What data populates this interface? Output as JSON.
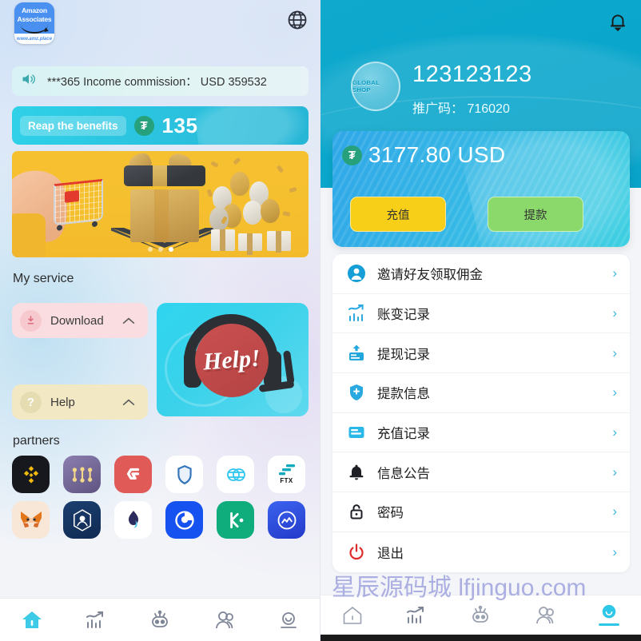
{
  "left": {
    "logo": {
      "line1": "Amazon",
      "line2": "Associates",
      "url": "www.amz.place",
      "icon": "amazon-logo"
    },
    "language_icon": "globe-icon",
    "notice": {
      "icon": "speaker-icon",
      "text": "***365 Income commission： USD 359532"
    },
    "reap": {
      "label": "Reap the benefits",
      "token_icon": "tether-icon",
      "token_symbol": "₮",
      "amount": "135"
    },
    "banner": {
      "alt": "promo-gift-banner",
      "dots": 3,
      "active_dot": 3
    },
    "service_title": "My service",
    "service_items": [
      {
        "label": "Download",
        "icon": "download-icon",
        "chevron": "chevron-up-icon"
      },
      {
        "label": "Help",
        "icon": "question-icon",
        "chevron": "chevron-up-icon"
      }
    ],
    "help_card": {
      "text": "Help!",
      "icon": "headset-icon"
    },
    "partners_title": "partners",
    "partners": [
      {
        "name": "binance",
        "bg": "#16181d",
        "fg": "#f0b90b"
      },
      {
        "name": "pancakeswap",
        "bg": "#6b5f8e",
        "fg": "#f3d27a"
      },
      {
        "name": "gate-io",
        "bg": "#e05a58",
        "fg": "#ffffff"
      },
      {
        "name": "trust-wallet",
        "bg": "#ffffff",
        "fg": "#3375bb"
      },
      {
        "name": "sushiswap",
        "bg": "#ffffff",
        "fg": "#2fc6ef"
      },
      {
        "name": "ftx",
        "bg": "#ffffff",
        "fg": "#11a9bc"
      },
      {
        "name": "metamask",
        "bg": "#f7e4d3",
        "fg": "#e2761b"
      },
      {
        "name": "crypto-com",
        "bg": "#12305c",
        "fg": "#ffffff"
      },
      {
        "name": "1inch",
        "bg": "#ffffff",
        "fg": "#2b2b5e"
      },
      {
        "name": "coinbase",
        "bg": "#1652f0",
        "fg": "#ffffff"
      },
      {
        "name": "kucoin",
        "bg": "#0fac7c",
        "fg": "#ffffff"
      },
      {
        "name": "coinmarketcap",
        "bg": "#2b4fdd",
        "fg": "#ffffff"
      }
    ],
    "tabs": [
      {
        "name": "home",
        "icon": "home-icon",
        "active": true
      },
      {
        "name": "market",
        "icon": "chart-icon",
        "active": false
      },
      {
        "name": "robot",
        "icon": "robot-icon",
        "active": false
      },
      {
        "name": "team",
        "icon": "people-icon",
        "active": false
      },
      {
        "name": "profile",
        "icon": "person-icon",
        "active": false
      }
    ]
  },
  "right": {
    "bell_icon": "bell-icon",
    "avatar": {
      "icon": "globe-shop-icon",
      "text": "GLOBAL SHOP"
    },
    "user_id": "123123123",
    "promo_code": "推广码： 716020",
    "balance": {
      "token_symbol": "₮",
      "token_icon": "tether-icon",
      "amount": "3177.80 USD"
    },
    "actions": [
      {
        "label": "充值",
        "name": "deposit"
      },
      {
        "label": "提款",
        "name": "withdraw"
      }
    ],
    "menu": [
      {
        "label": "邀请好友领取佣金",
        "icon": "user-circle-icon",
        "name": "invite-friends"
      },
      {
        "label": "账变记录",
        "icon": "chart-bars-icon",
        "name": "account-records"
      },
      {
        "label": "提现记录",
        "icon": "withdraw-card-icon",
        "name": "withdrawal-records"
      },
      {
        "label": "提款信息",
        "icon": "shield-plus-icon",
        "name": "withdrawal-info"
      },
      {
        "label": "充值记录",
        "icon": "card-icon",
        "name": "deposit-records"
      },
      {
        "label": "信息公告",
        "icon": "bell-icon",
        "name": "announcements"
      },
      {
        "label": "密码",
        "icon": "lock-icon",
        "name": "password"
      },
      {
        "label": "退出",
        "icon": "power-icon",
        "name": "logout"
      }
    ],
    "menu_arrow": "›",
    "tabs": [
      {
        "name": "home",
        "icon": "home-icon",
        "active": false
      },
      {
        "name": "market",
        "icon": "chart-icon",
        "active": false
      },
      {
        "name": "robot",
        "icon": "robot-icon",
        "active": false
      },
      {
        "name": "team",
        "icon": "people-icon",
        "active": false
      },
      {
        "name": "profile",
        "icon": "person-icon",
        "active": true
      }
    ]
  },
  "watermark": "星辰源码城 lfjinguo.com",
  "colors": {
    "header_cyan": "#0aa6cc",
    "accent_cyan": "#2fc7e8",
    "deposit_yellow": "#f7cf19",
    "withdraw_green": "#8bd96b",
    "tether_green": "#26a17b",
    "logout_red": "#e03131"
  }
}
